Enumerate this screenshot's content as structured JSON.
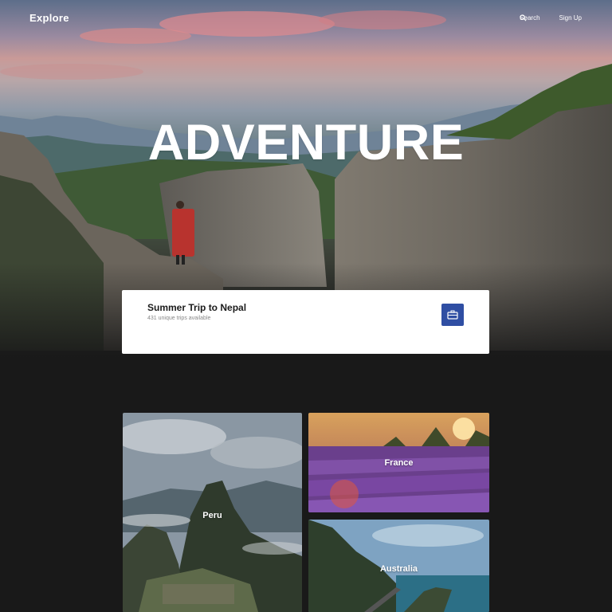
{
  "nav": {
    "brand": "Explore",
    "search_label": "Search",
    "signup_label": "Sign Up"
  },
  "hero": {
    "title": "ADVENTURE"
  },
  "trip_card": {
    "title": "Summer Trip to Nepal",
    "subtitle": "431 unique trips available",
    "icon": "briefcase-icon"
  },
  "destinations": [
    {
      "label": "Peru"
    },
    {
      "label": "France"
    },
    {
      "label": "Australia"
    }
  ],
  "colors": {
    "background": "#191919",
    "accent": "#2f4ea3",
    "card": "#ffffff"
  }
}
